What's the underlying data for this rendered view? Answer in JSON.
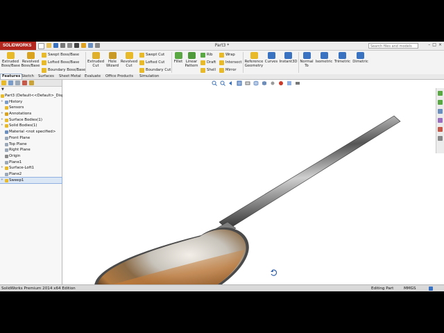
{
  "app": {
    "logo": "SOLIDWORKS",
    "document_title": "Part3 *"
  },
  "search": {
    "placeholder": "Search files and models"
  },
  "window_controls": [
    "–",
    "□",
    "×"
  ],
  "ribbon": {
    "extruded_boss": "Extruded Boss/Base",
    "revolved_boss": "Revolved Boss/Base",
    "swept_boss": "Swept Boss/Base",
    "lofted_boss": "Lofted Boss/Base",
    "boundary_boss": "Boundary Boss/Base",
    "extruded_cut": "Extruded Cut",
    "hole_wizard": "Hole Wizard",
    "revolved_cut": "Revolved Cut",
    "swept_cut": "Swept Cut",
    "lofted_cut": "Lofted Cut",
    "boundary_cut": "Boundary Cut",
    "fillet": "Fillet",
    "linear_pattern": "Linear Pattern",
    "rib": "Rib",
    "draft": "Draft",
    "shell": "Shell",
    "wrap": "Wrap",
    "intersect": "Intersect",
    "mirror": "Mirror",
    "reference_geometry": "Reference Geometry",
    "curves": "Curves",
    "instant3d": "Instant3D",
    "normal_to": "Normal To",
    "isometric": "Isometric",
    "trimetric": "Trimetric",
    "dimetric": "Dimetric"
  },
  "tabs": [
    "Features",
    "Sketch",
    "Surfaces",
    "Sheet Metal",
    "Evaluate",
    "Office Products",
    "Simulation"
  ],
  "tree": {
    "root": "Part3  (Default<<Default>_Disp",
    "items": [
      "History",
      "Sensors",
      "Annotations",
      "Surface Bodies(1)",
      "Solid Bodies(1)",
      "Material <not specified>",
      "Front Plane",
      "Top Plane",
      "Right Plane",
      "Origin",
      "Plane1",
      "Surface-Loft1",
      "Plane2",
      "Sweep1"
    ]
  },
  "status": {
    "edition": "SolidWorks Premium 2014 x64 Edition",
    "mode": "Editing Part",
    "units": "MMGS"
  },
  "colors": {
    "brand": "#b3261e",
    "selection": "#dce7f6",
    "ribbon_icon_yellow": "#e8b929",
    "ribbon_icon_green": "#5aa844",
    "ribbon_icon_blue": "#3a72c2"
  }
}
